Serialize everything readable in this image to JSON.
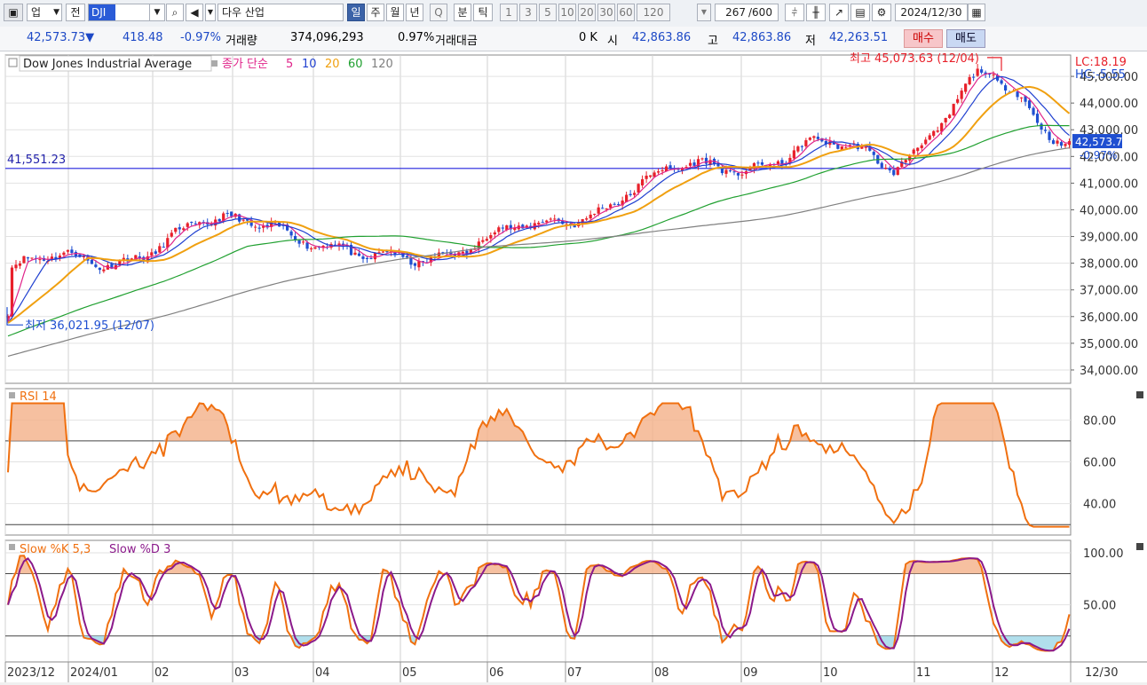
{
  "toolbar": {
    "market_label": "업",
    "period_label": "전",
    "symbol_code": "DJI",
    "symbol_name": "다우 산업",
    "timeframes": [
      "일",
      "주",
      "월",
      "년",
      "Q",
      "분",
      "틱"
    ],
    "minute_options": [
      "1",
      "3",
      "5",
      "10",
      "20",
      "30",
      "60",
      "120"
    ],
    "active_timeframe": "일",
    "count": "267",
    "count_total": "/600",
    "date": "2024/12/30"
  },
  "quote": {
    "price": "42,573.73",
    "change": "418.48",
    "change_pct": "-0.97%",
    "volume_label": "거래량",
    "volume": "374,096,293",
    "amount_pct": "0.97%",
    "amount_label": "거래대금",
    "amount": "0 K",
    "open_label": "시",
    "open": "42,863.86",
    "high_label": "고",
    "high": "42,863.86",
    "low_label": "저",
    "low": "42,263.51",
    "buy_label": "매수",
    "sell_label": "매도"
  },
  "chart_data": [
    {
      "type": "candlestick",
      "title": "Dow Jones Industrial Average",
      "indicator_label": "종가 단순",
      "ma_periods": [
        "5",
        "10",
        "20",
        "60",
        "120"
      ],
      "ma_colors": {
        "5": "#e0248a",
        "10": "#2040d0",
        "20": "#f0a010",
        "60": "#20a030",
        "120": "#808080"
      },
      "ylim": [
        33500,
        45800
      ],
      "y_ticks": [
        "45,000.00",
        "44,000.00",
        "43,000.00",
        "42,000.00",
        "41,000.00",
        "40,000.00",
        "39,000.00",
        "38,000.00",
        "37,000.00",
        "36,000.00",
        "35,000.00",
        "34,000.00"
      ],
      "x_labels": [
        "2023/12",
        "2024/01",
        "02",
        "03",
        "04",
        "05",
        "06",
        "07",
        "08",
        "09",
        "10",
        "11",
        "12",
        "12/30"
      ],
      "lc_label": "LC:18.19",
      "hc_label": "HC:-5.55",
      "last_price_label": "42,573.73",
      "last_change_label": "-0.97%",
      "hline_value": 41551.23,
      "hline_label": "41,551.23",
      "max_label": "최고 45,073.63 (12/04)",
      "min_label": "최저 36,021.95 (12/07)",
      "monthly_close": [
        {
          "m": "2023/12",
          "v": 37690
        },
        {
          "m": "2024/01",
          "v": 38150
        },
        {
          "m": "02",
          "v": 38996
        },
        {
          "m": "03",
          "v": 39807
        },
        {
          "m": "04",
          "v": 37815
        },
        {
          "m": "05",
          "v": 38686
        },
        {
          "m": "06",
          "v": 39118
        },
        {
          "m": "07",
          "v": 40842
        },
        {
          "m": "08",
          "v": 41563
        },
        {
          "m": "09",
          "v": 42330
        },
        {
          "m": "10",
          "v": 41763
        },
        {
          "m": "11",
          "v": 44910
        },
        {
          "m": "12",
          "v": 42573
        }
      ]
    },
    {
      "type": "line",
      "title": "RSI 14",
      "ylim": [
        25,
        95
      ],
      "y_ticks": [
        "80.00",
        "60.00",
        "40.00"
      ],
      "levels": [
        70,
        30
      ]
    },
    {
      "type": "line",
      "title": "Slow %K 5,3",
      "series": [
        {
          "name": "Slow %K 5,3",
          "color": "#f07010"
        },
        {
          "name": "Slow %D 3",
          "color": "#8b1a8b"
        }
      ],
      "ylim": [
        -5,
        112
      ],
      "y_ticks": [
        "100.00",
        "50.00"
      ],
      "levels": [
        80,
        20
      ]
    }
  ]
}
